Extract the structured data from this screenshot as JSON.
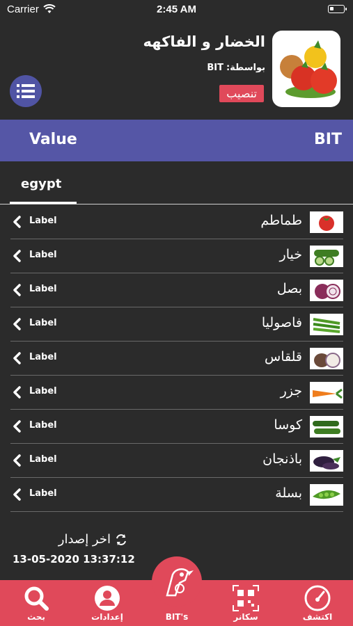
{
  "status_bar": {
    "carrier": "Carrier",
    "time": "2:45 AM"
  },
  "app": {
    "title": "الخضار و الفاكهه",
    "by_label": "بواسطة:",
    "by_value": "BIT",
    "install_label": "تنصيب"
  },
  "header_bar": {
    "left": "Value",
    "right": "BIT"
  },
  "tabs": [
    {
      "label": "egypt"
    }
  ],
  "items": [
    {
      "name": "طماطم",
      "label": "Label",
      "icon": "tomato"
    },
    {
      "name": "خيار",
      "label": "Label",
      "icon": "cucumber"
    },
    {
      "name": "بصل",
      "label": "Label",
      "icon": "onion"
    },
    {
      "name": "فاصوليا",
      "label": "Label",
      "icon": "beans"
    },
    {
      "name": "قلقاس",
      "label": "Label",
      "icon": "taro"
    },
    {
      "name": "جزر",
      "label": "Label",
      "icon": "carrot"
    },
    {
      "name": "كوسا",
      "label": "Label",
      "icon": "zucchini"
    },
    {
      "name": "باذنجان",
      "label": "Label",
      "icon": "eggplant"
    },
    {
      "name": "بسلة",
      "label": "Label",
      "icon": "peas"
    }
  ],
  "footer": {
    "last_version_label": "اخر إصدار",
    "timestamp": "13-05-2020 13:37:12"
  },
  "tab_bar": {
    "search": "بحث",
    "settings": "إعدادات",
    "center": "BIT's",
    "scanner": "سكانر",
    "discover": "اكتشف"
  },
  "colors": {
    "accent": "#e0495a",
    "bar": "#5556a6",
    "background": "#2b2b2b"
  }
}
